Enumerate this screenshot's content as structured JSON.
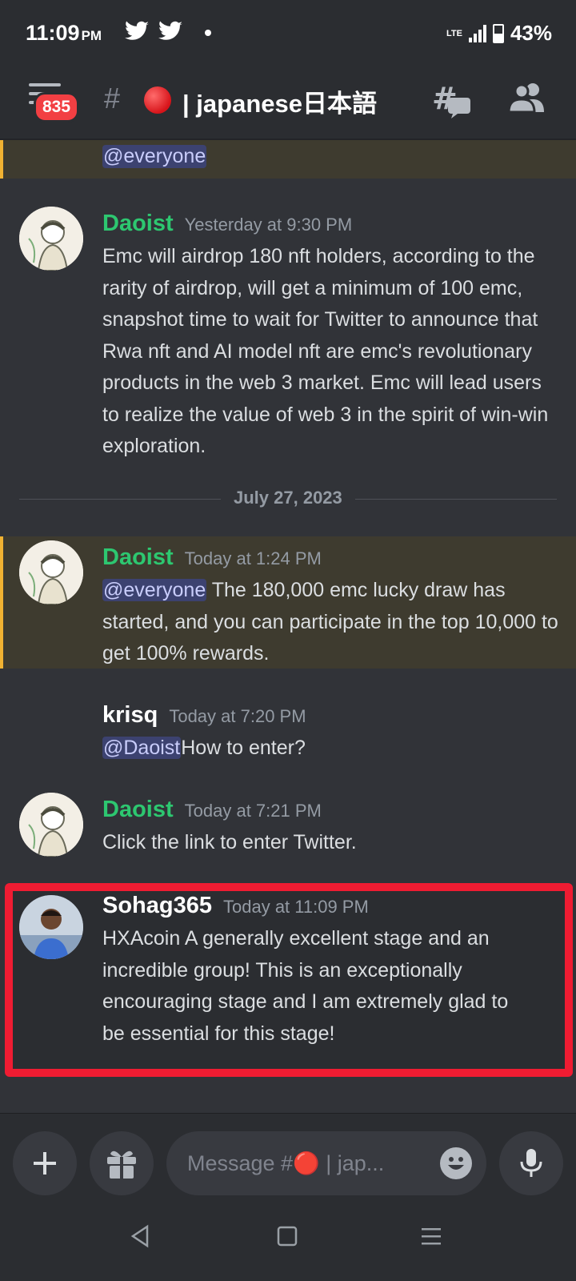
{
  "status_bar": {
    "time": "11:09",
    "ampm": "PM",
    "network": "LTE",
    "battery": "43%"
  },
  "header": {
    "unread_badge": "835",
    "channel_name": "| japanese日本語"
  },
  "messages": {
    "top_mention": "@everyone",
    "m1": {
      "author": "Daoist",
      "time": "Yesterday at 9:30 PM",
      "text": "Emc will airdrop 180 nft holders, according to the rarity of airdrop, will get a minimum of 100 emc, snapshot time to wait for Twitter to announce that Rwa nft and AI model nft are emc's revolutionary products in the web 3 market. Emc will lead users to realize the value of web 3 in the spirit of win-win exploration."
    },
    "date_divider": "July 27, 2023",
    "m2": {
      "author": "Daoist",
      "time": "Today at 1:24 PM",
      "mention": "@everyone",
      "text": " The 180,000 emc lucky draw has started, and you can participate in the top 10,000 to get 100% rewards."
    },
    "m3": {
      "author": "krisq",
      "time": "Today at 7:20 PM",
      "mention": "@Daoist",
      "text": "How to enter?"
    },
    "m4": {
      "author": "Daoist",
      "time": "Today at 7:21 PM",
      "text": "Click the link to enter Twitter."
    },
    "m5": {
      "author": "Sohag365",
      "time": "Today at 11:09 PM",
      "text": "HXAcoin A generally excellent stage and an incredible group! This is an exceptionally encouraging stage and I am extremely glad to be essential for this stage!"
    }
  },
  "input": {
    "placeholder": "Message #🔴 | jap..."
  },
  "colors": {
    "mention_bg": "#3c4270",
    "highlight_border": "#ef1c32",
    "author_green": "#2dc770"
  }
}
